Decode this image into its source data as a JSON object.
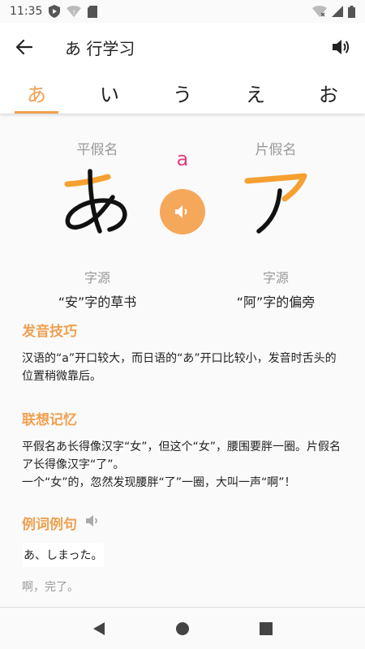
{
  "status": {
    "time": "11:35"
  },
  "toolbar": {
    "title": "あ 行学习"
  },
  "tabs": [
    {
      "label": "あ",
      "active": true
    },
    {
      "label": "い",
      "active": false
    },
    {
      "label": "う",
      "active": false
    },
    {
      "label": "え",
      "active": false
    },
    {
      "label": "お",
      "active": false
    }
  ],
  "kana": {
    "hiragana_label": "平假名",
    "hiragana_char": "あ",
    "katakana_label": "片假名",
    "katakana_char": "ア",
    "romaji": "a",
    "hiragana_source_label": "字源",
    "hiragana_source": "“安”字的草书",
    "katakana_source_label": "字源",
    "katakana_source": "“阿”字的偏旁"
  },
  "pronunciation": {
    "title": "发音技巧",
    "text": "汉语的“a”开口较大，而日语的“あ”开口比较小，发音时舌头的位置稍微靠后。"
  },
  "memory": {
    "title": "联想记忆",
    "line1": "平假名あ长得像汉字“女”，但这个“女”，腰围要胖一圈。片假名ア长得像汉字“了”。",
    "line2": "一个“女”的，忽然发现腰胖“了”一圈，大叫一声“啊”！"
  },
  "examples": {
    "title": "例词例句",
    "jp": "あ、しまった。",
    "cn": "啊，完了。"
  },
  "colors": {
    "accent": "#f0a050",
    "romaji": "#e73b7e",
    "play": "#f6a85a"
  }
}
